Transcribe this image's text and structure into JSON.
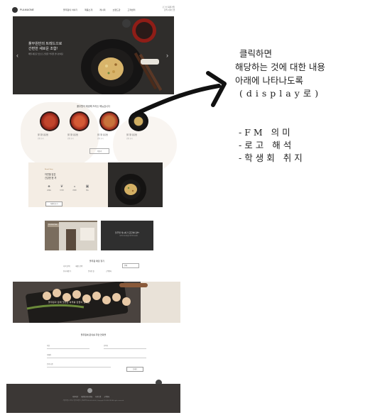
{
  "mockup": {
    "brand": "PULMUONE",
    "nav": [
      "풀무원의 이야기",
      "제품소개",
      "레시피",
      "브랜드관",
      "고객센터"
    ],
    "util": [
      "로그인 회원가입",
      "검색 사이트맵"
    ],
    "hero": {
      "title_line1": "풀무원만의 트레드으로",
      "title_line2": "간편한 새로운 조합!",
      "subtitle": "매일 새로운 맛으로 건강한 식탁을 만나보세요",
      "prev_label": "‹",
      "next_label": "›"
    },
    "products": {
      "section_title": "풀무원이 제공해 드리는 메뉴입니다",
      "items": [
        {
          "name": "풀무원 볶음밥",
          "desc": "간편 조리"
        },
        {
          "name": "풀무원 볶음밥",
          "desc": "간편 조리"
        },
        {
          "name": "풀무원 볶음밥",
          "desc": "간편 조리"
        },
        {
          "name": "풀무원 볶음밥",
          "desc": "간편 조리"
        }
      ],
      "more_label": "더보기"
    },
    "feature": {
      "small": "Brand Story",
      "title_line1": "자연을 담은",
      "title_line2": "건강한 한 끼",
      "icons": [
        {
          "icon": "bottle-icon",
          "glyph": "♣",
          "label": "원재료"
        },
        {
          "icon": "leaf-icon",
          "glyph": "❦",
          "label": "신선함"
        },
        {
          "icon": "bowl-icon",
          "glyph": "◒",
          "label": "간편함"
        },
        {
          "icon": "box-icon",
          "glyph": "▣",
          "label": "배송"
        }
      ],
      "button": "자세히 보기"
    },
    "cards": {
      "photo_label": "PULMUONE",
      "dark_title": "풀무원 레시피가 궁금하다면?",
      "dark_desc": "다양한 요리법을 확인해 보세요"
    },
    "info": {
      "title": "풀무원 매장 찾기",
      "labels": [
        "지역 선택",
        "매장 선택"
      ],
      "select": "전체",
      "stats": [
        "전국 매장 수",
        "온라인 몰",
        "고객센터"
      ]
    },
    "banner": {
      "text": "풀무원과 함께 맛있는 하루를 만들어 보세요"
    },
    "form": {
      "title": "풀무원에 문의를 주면 연락을",
      "fields": [
        "이름",
        "연락처",
        "이메일",
        "문의 내용"
      ],
      "submit": "보내기"
    },
    "footer": {
      "links": [
        "이용약관",
        "개인정보처리방침",
        "사이트맵",
        "고객센터"
      ],
      "address": "서울특별시 강남구 풀무원빌딩 | 대표전화 080-000-0000 | Copyright PULMUONE All rights reserved."
    }
  },
  "annotation": {
    "note_line1": "클릭하면",
    "note_line2": "해당하는 것에 대한 내용",
    "note_line3": "아래에 나타나도록",
    "note_line4": "(display로)",
    "bullets": [
      "-FM 의미",
      "-로고 해석",
      "-학생회 취지"
    ],
    "arrow_color": "#111111"
  },
  "colors": {
    "hero_bg": "#2f2d2b",
    "feature_bg": "#f4ede4",
    "footer_bg": "#3b3735",
    "bowl_red": "#a0281d"
  }
}
